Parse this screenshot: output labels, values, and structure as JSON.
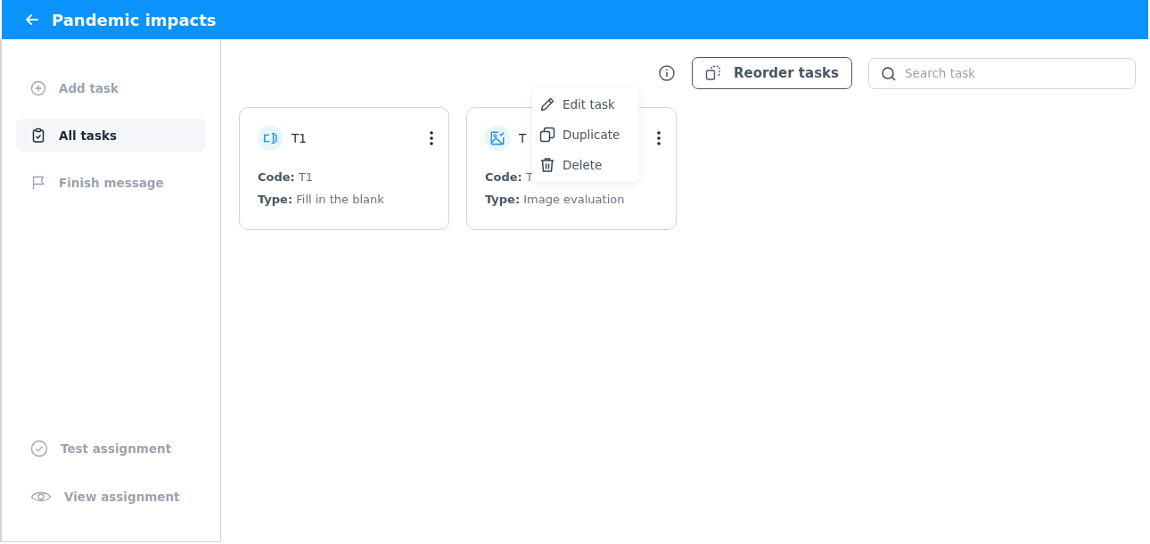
{
  "header": {
    "title": "Pandemic impacts"
  },
  "sidebar": {
    "items": [
      {
        "label": "Add task",
        "selected": false
      },
      {
        "label": "All tasks",
        "selected": true
      },
      {
        "label": "Finish message",
        "selected": false
      }
    ],
    "bottom_items": [
      {
        "label": "Test assignment"
      },
      {
        "label": "View assignment"
      }
    ]
  },
  "toolbar": {
    "reorder_button": "Reorder tasks",
    "search": {
      "placeholder": "Search task"
    }
  },
  "tasks": [
    {
      "title": "T1",
      "kind": "fill",
      "code_label": "Code:",
      "code": "T1",
      "type_label": "Type:",
      "type": "Fill in the blank",
      "menu_open": false
    },
    {
      "title": "T",
      "kind": "image",
      "code_label": "Code:",
      "code": "T",
      "type_label": "Type:",
      "type": "Image evaluation",
      "menu_open": true
    }
  ],
  "context_menu": [
    {
      "label": "Edit task"
    },
    {
      "label": "Duplicate"
    },
    {
      "label": "Delete"
    }
  ]
}
